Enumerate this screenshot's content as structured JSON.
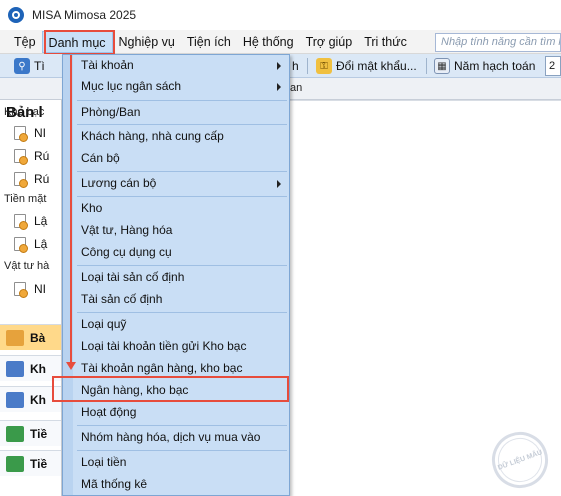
{
  "window": {
    "title": "MISA Mimosa 2025"
  },
  "menubar": {
    "items": [
      "Tệp",
      "Danh mục",
      "Nghiệp vụ",
      "Tiện ích",
      "Hệ thống",
      "Trợ giúp",
      "Tri thức"
    ],
    "search_placeholder": "Nhập tính năng cần tìm k"
  },
  "toolbar": {
    "frag1": "Tì",
    "frag2": "h",
    "change_password": "Đổi mật khẩu...",
    "fiscal_year": "Năm hạch toán",
    "year_frag": "2"
  },
  "tabstrip": {
    "frag": "an"
  },
  "left_panel": {
    "title": "Bản l",
    "groups": [
      {
        "label": "Kho bạc",
        "docs": [
          "NI",
          "Rú",
          "Rú"
        ]
      },
      {
        "label": "Tiền mặt",
        "docs": [
          "Lậ",
          "Lậ"
        ]
      },
      {
        "label": "Vật tư hà",
        "docs": [
          "NI"
        ]
      }
    ],
    "nav": [
      {
        "label": "Bà",
        "color": "#e6a23c",
        "selected": true
      },
      {
        "label": "Kh",
        "color": "#4a7bc8",
        "selected": false
      },
      {
        "label": "Kh",
        "color": "#4a7bc8",
        "selected": false
      },
      {
        "label": "Tiề",
        "color": "#3a9a4a",
        "selected": false
      },
      {
        "label": "Tiề",
        "color": "#3a9a4a",
        "selected": false
      }
    ]
  },
  "dropdown": {
    "items": [
      {
        "label": "Tài khoản",
        "submenu": true
      },
      {
        "label": "Mục lục ngân sách",
        "submenu": true
      },
      {
        "label": "Phòng/Ban",
        "submenu": false
      },
      {
        "label": "Khách hàng, nhà cung cấp",
        "submenu": false
      },
      {
        "label": "Cán bộ",
        "submenu": false
      },
      {
        "label": "Lương cán bộ",
        "submenu": true
      },
      {
        "label": "Kho",
        "submenu": false
      },
      {
        "label": "Vật tư, Hàng hóa",
        "submenu": false
      },
      {
        "label": "Công cụ dụng cụ",
        "submenu": false
      },
      {
        "label": "Loại tài sản cố định",
        "submenu": false
      },
      {
        "label": "Tài sản cố định",
        "submenu": false
      },
      {
        "label": "Loại quỹ",
        "submenu": false
      },
      {
        "label": "Loại tài khoản tiền gửi Kho bạc",
        "submenu": false
      },
      {
        "label": "Tài khoản ngân hàng, kho bạc",
        "submenu": false
      },
      {
        "label": "Ngân hàng, kho bạc",
        "submenu": false
      },
      {
        "label": "Hoạt động",
        "submenu": false
      },
      {
        "label": "Nhóm hàng hóa, dịch vụ mua vào",
        "submenu": false
      },
      {
        "label": "Loại tiền",
        "submenu": false
      },
      {
        "label": "Mã thống kê",
        "submenu": false
      }
    ]
  },
  "stamp": {
    "text": "DỮ LIỆU MẪU"
  }
}
